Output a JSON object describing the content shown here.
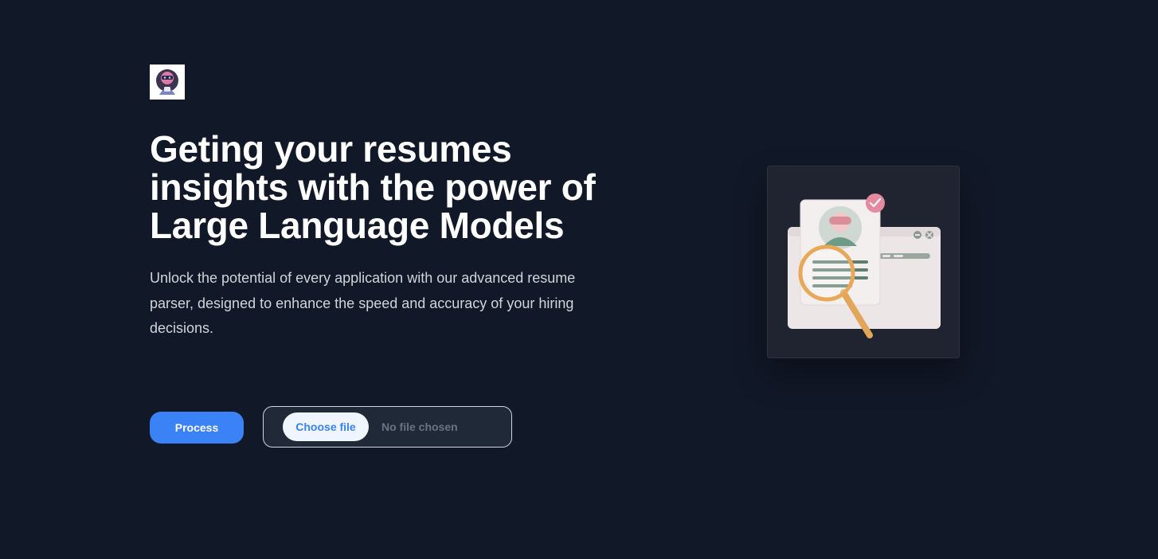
{
  "hero": {
    "logo_icon": "robot-avatar-icon",
    "headline": "Geting your resumes insights with the power of Large Language Models",
    "description": "Unlock the potential of every application with our advanced resume parser, designed to enhance the speed and accuracy of your hiring decisions."
  },
  "actions": {
    "process_label": "Process",
    "choose_file_label": "Choose file",
    "no_file_label": "No file chosen"
  },
  "illustration": {
    "icon": "resume-magnifier-icon"
  },
  "colors": {
    "background": "#111827",
    "accent": "#3b82f6",
    "card": "#1f2430"
  }
}
